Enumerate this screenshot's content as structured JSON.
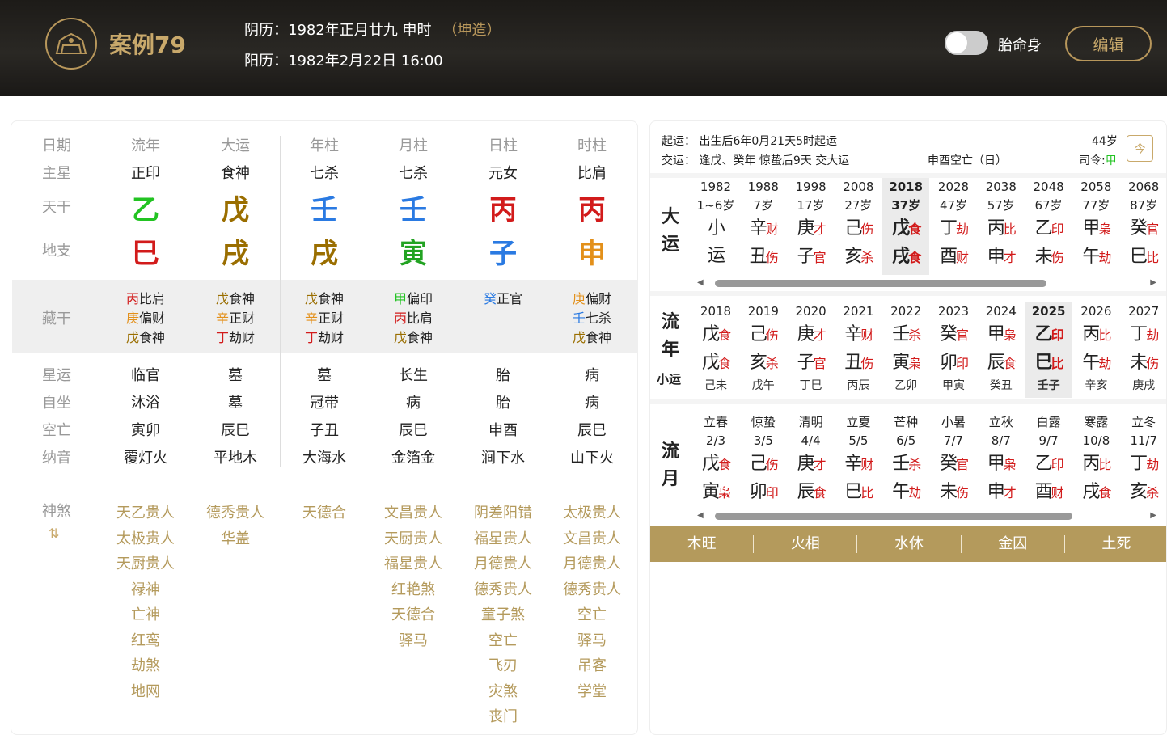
{
  "header": {
    "case_title": "案例79",
    "lunar": "阴历：1982年正月廿九 申时",
    "sex": "（坤造）",
    "solar": "阳历：1982年2月22日 16:00",
    "toggle_label": "胎命身",
    "edit_label": "编辑"
  },
  "left": {
    "labels": [
      "日期",
      "主星",
      "天干",
      "地支",
      "藏干",
      "星运",
      "自坐",
      "空亡",
      "纳音",
      "神煞"
    ],
    "columns": [
      {
        "title": "流年",
        "main": "正印",
        "stem": "乙",
        "stem_color": "#22c322",
        "branch": "巳",
        "branch_color": "#d21b1b",
        "hidden": [
          [
            "丙",
            "比肩",
            "#d21b1b"
          ],
          [
            "庚",
            "偏财",
            "#e3901a"
          ],
          [
            "戊",
            "食神",
            "#9a6e00"
          ]
        ],
        "xingyun": "临官",
        "zizuo": "沐浴",
        "kongwang": "寅卯",
        "nayin": "覆灯火",
        "shensha": [
          "天乙贵人",
          "太极贵人",
          "天厨贵人",
          "禄神",
          "亡神",
          "红鸾",
          "劫煞",
          "地网"
        ]
      },
      {
        "title": "大运",
        "main": "食神",
        "stem": "戊",
        "stem_color": "#9a6e00",
        "branch": "戌",
        "branch_color": "#9a6e00",
        "hidden": [
          [
            "戊",
            "食神",
            "#9a6e00"
          ],
          [
            "辛",
            "正财",
            "#e3901a"
          ],
          [
            "丁",
            "劫财",
            "#d21b1b"
          ]
        ],
        "xingyun": "墓",
        "zizuo": "墓",
        "kongwang": "辰巳",
        "nayin": "平地木",
        "shensha": [
          "德秀贵人",
          "华盖"
        ]
      },
      {
        "title": "年柱",
        "main": "七杀",
        "stem": "壬",
        "stem_color": "#2a7ae2",
        "branch": "戌",
        "branch_color": "#9a6e00",
        "hidden": [
          [
            "戊",
            "食神",
            "#9a6e00"
          ],
          [
            "辛",
            "正财",
            "#e3901a"
          ],
          [
            "丁",
            "劫财",
            "#d21b1b"
          ]
        ],
        "xingyun": "墓",
        "zizuo": "冠带",
        "kongwang": "子丑",
        "nayin": "大海水",
        "shensha": [
          "天德合"
        ]
      },
      {
        "title": "月柱",
        "main": "七杀",
        "stem": "壬",
        "stem_color": "#2a7ae2",
        "branch": "寅",
        "branch_color": "#22a322",
        "hidden": [
          [
            "甲",
            "偏印",
            "#22c322"
          ],
          [
            "丙",
            "比肩",
            "#d21b1b"
          ],
          [
            "戊",
            "食神",
            "#9a6e00"
          ]
        ],
        "xingyun": "长生",
        "zizuo": "病",
        "kongwang": "辰巳",
        "nayin": "金箔金",
        "shensha": [
          "文昌贵人",
          "天厨贵人",
          "福星贵人",
          "红艳煞",
          "天德合",
          "驿马"
        ]
      },
      {
        "title": "日柱",
        "main": "元女",
        "stem": "丙",
        "stem_color": "#d21b1b",
        "branch": "子",
        "branch_color": "#2a7ae2",
        "hidden": [
          [
            "癸",
            "正官",
            "#2a7ae2"
          ]
        ],
        "xingyun": "胎",
        "zizuo": "胎",
        "kongwang": "申酉",
        "nayin": "涧下水",
        "shensha": [
          "阴差阳错",
          "福星贵人",
          "月德贵人",
          "德秀贵人",
          "童子煞",
          "空亡",
          "飞刃",
          "灾煞",
          "丧门"
        ]
      },
      {
        "title": "时柱",
        "main": "比肩",
        "stem": "丙",
        "stem_color": "#d21b1b",
        "branch": "申",
        "branch_color": "#e3901a",
        "hidden": [
          [
            "庚",
            "偏财",
            "#e3901a"
          ],
          [
            "壬",
            "七杀",
            "#2a7ae2"
          ],
          [
            "戊",
            "食神",
            "#9a6e00"
          ]
        ],
        "xingyun": "病",
        "zizuo": "病",
        "kongwang": "辰巳",
        "nayin": "山下火",
        "shensha": [
          "太极贵人",
          "文昌贵人",
          "月德贵人",
          "德秀贵人",
          "空亡",
          "驿马",
          "吊客",
          "学堂"
        ]
      }
    ],
    "shensha_icon": "swap-arrows-icon"
  },
  "right": {
    "qiyun": "起运：  出生后6年0月21天5时起运",
    "jiaoyun": "交运：  逢戊、癸年 惊蛰后9天 交大运",
    "kongwang": "申酉空亡（日）",
    "age": "44岁",
    "siling_label": "司令:",
    "siling_value": "甲",
    "cal_icon": "今",
    "dayun_label": "大运",
    "liunian_label": "流年",
    "xiaoyun_label": "小运",
    "liuyue_label": "流月",
    "dayun": [
      {
        "y": "1982",
        "a": "1~6岁",
        "g1": "小",
        "g2": "运",
        "s1": "",
        "s2": ""
      },
      {
        "y": "1988",
        "a": "7岁",
        "g1": "辛",
        "s1": "财",
        "g2": "丑",
        "s2": "伤"
      },
      {
        "y": "1998",
        "a": "17岁",
        "g1": "庚",
        "s1": "才",
        "g2": "子",
        "s2": "官"
      },
      {
        "y": "2008",
        "a": "27岁",
        "g1": "己",
        "s1": "伤",
        "g2": "亥",
        "s2": "杀"
      },
      {
        "y": "2018",
        "a": "37岁",
        "g1": "戊",
        "s1": "食",
        "g2": "戌",
        "s2": "食"
      },
      {
        "y": "2028",
        "a": "47岁",
        "g1": "丁",
        "s1": "劫",
        "g2": "酉",
        "s2": "财"
      },
      {
        "y": "2038",
        "a": "57岁",
        "g1": "丙",
        "s1": "比",
        "g2": "申",
        "s2": "才"
      },
      {
        "y": "2048",
        "a": "67岁",
        "g1": "乙",
        "s1": "印",
        "g2": "未",
        "s2": "伤"
      },
      {
        "y": "2058",
        "a": "77岁",
        "g1": "甲",
        "s1": "枭",
        "g2": "午",
        "s2": "劫"
      },
      {
        "y": "2068",
        "a": "87岁",
        "g1": "癸",
        "s1": "官",
        "g2": "巳",
        "s2": "比"
      }
    ],
    "liunian": [
      {
        "y": "2018",
        "g1": "戊",
        "s1": "食",
        "g2": "戊",
        "s2": "食",
        "x": "己未"
      },
      {
        "y": "2019",
        "g1": "己",
        "s1": "伤",
        "g2": "亥",
        "s2": "杀",
        "x": "戊午"
      },
      {
        "y": "2020",
        "g1": "庚",
        "s1": "才",
        "g2": "子",
        "s2": "官",
        "x": "丁巳"
      },
      {
        "y": "2021",
        "g1": "辛",
        "s1": "财",
        "g2": "丑",
        "s2": "伤",
        "x": "丙辰"
      },
      {
        "y": "2022",
        "g1": "壬",
        "s1": "杀",
        "g2": "寅",
        "s2": "枭",
        "x": "乙卯"
      },
      {
        "y": "2023",
        "g1": "癸",
        "s1": "官",
        "g2": "卯",
        "s2": "印",
        "x": "甲寅"
      },
      {
        "y": "2024",
        "g1": "甲",
        "s1": "枭",
        "g2": "辰",
        "s2": "食",
        "x": "癸丑"
      },
      {
        "y": "2025",
        "g1": "乙",
        "s1": "印",
        "g2": "巳",
        "s2": "比",
        "x": "壬子"
      },
      {
        "y": "2026",
        "g1": "丙",
        "s1": "比",
        "g2": "午",
        "s2": "劫",
        "x": "辛亥"
      },
      {
        "y": "2027",
        "g1": "丁",
        "s1": "劫",
        "g2": "未",
        "s2": "伤",
        "x": "庚戌"
      }
    ],
    "liuyue": [
      {
        "j": "立春",
        "d": "2/3",
        "g1": "戊",
        "s1": "食",
        "g2": "寅",
        "s2": "枭"
      },
      {
        "j": "惊蛰",
        "d": "3/5",
        "g1": "己",
        "s1": "伤",
        "g2": "卯",
        "s2": "印"
      },
      {
        "j": "清明",
        "d": "4/4",
        "g1": "庚",
        "s1": "才",
        "g2": "辰",
        "s2": "食"
      },
      {
        "j": "立夏",
        "d": "5/5",
        "g1": "辛",
        "s1": "财",
        "g2": "巳",
        "s2": "比"
      },
      {
        "j": "芒种",
        "d": "6/5",
        "g1": "壬",
        "s1": "杀",
        "g2": "午",
        "s2": "劫"
      },
      {
        "j": "小暑",
        "d": "7/7",
        "g1": "癸",
        "s1": "官",
        "g2": "未",
        "s2": "伤"
      },
      {
        "j": "立秋",
        "d": "8/7",
        "g1": "甲",
        "s1": "枭",
        "g2": "申",
        "s2": "才"
      },
      {
        "j": "白露",
        "d": "9/7",
        "g1": "乙",
        "s1": "印",
        "g2": "酉",
        "s2": "财"
      },
      {
        "j": "寒露",
        "d": "10/8",
        "g1": "丙",
        "s1": "比",
        "g2": "戌",
        "s2": "食"
      },
      {
        "j": "立冬",
        "d": "11/7",
        "g1": "丁",
        "s1": "劫",
        "g2": "亥",
        "s2": "杀"
      }
    ],
    "wuxing": [
      "木旺",
      "火相",
      "水休",
      "金囚",
      "土死"
    ]
  }
}
